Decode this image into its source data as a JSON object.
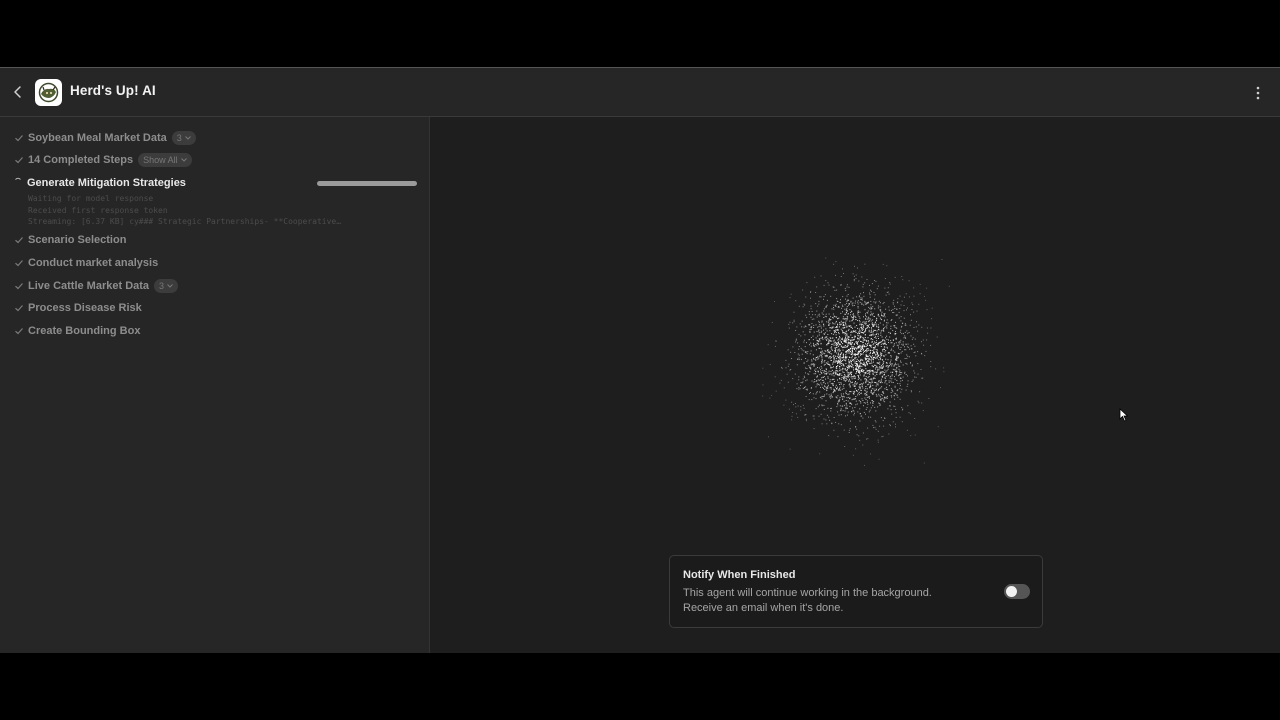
{
  "app": {
    "title": "Herd's Up! AI"
  },
  "icons": {
    "back": "chevron-left-icon",
    "logo": "herds-up-logo",
    "menu": "vertical-dots-icon",
    "check": "check-icon",
    "chevron": "chevron-down-icon",
    "cursor": "mouse-pointer-icon"
  },
  "steps_before": [
    {
      "label": "Soybean Meal Market Data",
      "badge": "3"
    },
    {
      "label": "14 Completed Steps",
      "badge": "Show All"
    }
  ],
  "active_step": {
    "label": "Generate Mitigation Strategies",
    "progress": 1.0,
    "logs": [
      "Waiting for model response",
      "Received first response token",
      "Streaming: [6.37 KB] cy### Strategic Partnerships- **Cooperative…"
    ]
  },
  "steps_after": [
    {
      "label": "Scenario Selection",
      "badge": ""
    },
    {
      "label": "Conduct market analysis",
      "badge": ""
    },
    {
      "label": "Live Cattle Market Data",
      "badge": "3"
    },
    {
      "label": "Process Disease Risk",
      "badge": ""
    },
    {
      "label": "Create Bounding Box",
      "badge": ""
    }
  ],
  "notify": {
    "title": "Notify When Finished",
    "line1": "This agent will continue working in the background.",
    "line2": "Receive an email when it's done.",
    "enabled": false
  },
  "colors": {
    "page_bg": "#000000",
    "panel_bg": "#1e1e1e",
    "sidebar_bg": "#262626",
    "text_primary": "#f2f2f2",
    "text_muted": "#8d8d8d"
  }
}
